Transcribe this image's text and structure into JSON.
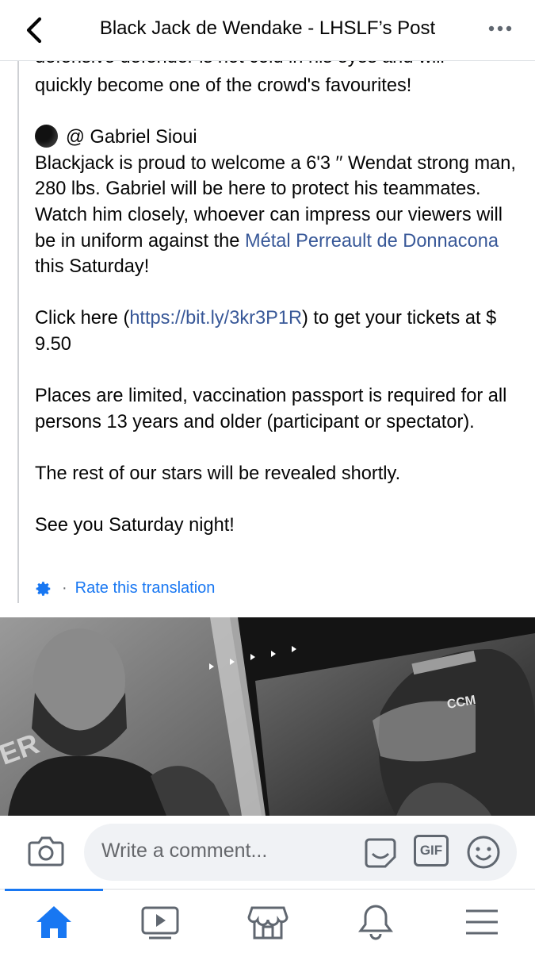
{
  "header": {
    "title": "Black Jack de Wendake - LHSLF’s Post"
  },
  "post": {
    "cut_line": "defensive defender is not cold in his eyes and will",
    "line_favourites": "quickly become one of the crowd's favourites!",
    "mention": "@ Gabriel Sioui",
    "para1_text": "Blackjack is proud to welcome a 6'3 ′′ Wendat strong man, 280 lbs. Gabriel will be here to protect his teammates. Watch him closely, whoever can impress our viewers will be in uniform against the ",
    "para1_link": "Métal Perreault de Donnacona",
    "para1_end": " this Saturday!",
    "para2_start": "Click here (",
    "para2_link": "https://bit.ly/3kr3P1R",
    "para2_end": ") to get your tickets at $ 9.50",
    "para3": "Places are limited, vaccination passport is required for all persons 13 years and older (participant or spectator).",
    "para4": "The rest of our stars will be revealed shortly.",
    "para5": "See you Saturday night!",
    "rate_translation": "Rate this translation"
  },
  "composer": {
    "placeholder": "Write a comment...",
    "gif_label": "GIF"
  },
  "icons": {
    "back": "chevron-left-icon",
    "more": "more-horizontal-icon",
    "settings": "gear-icon",
    "camera": "camera-icon",
    "sticker": "sticker-icon",
    "gif": "gif-icon",
    "emoji": "emoji-icon",
    "tabs": [
      "home-icon",
      "video-icon",
      "marketplace-icon",
      "notifications-icon",
      "menu-icon"
    ]
  },
  "colors": {
    "accent": "#1877f2",
    "link": "#385898",
    "text": "#050505",
    "muted": "#65676b"
  }
}
